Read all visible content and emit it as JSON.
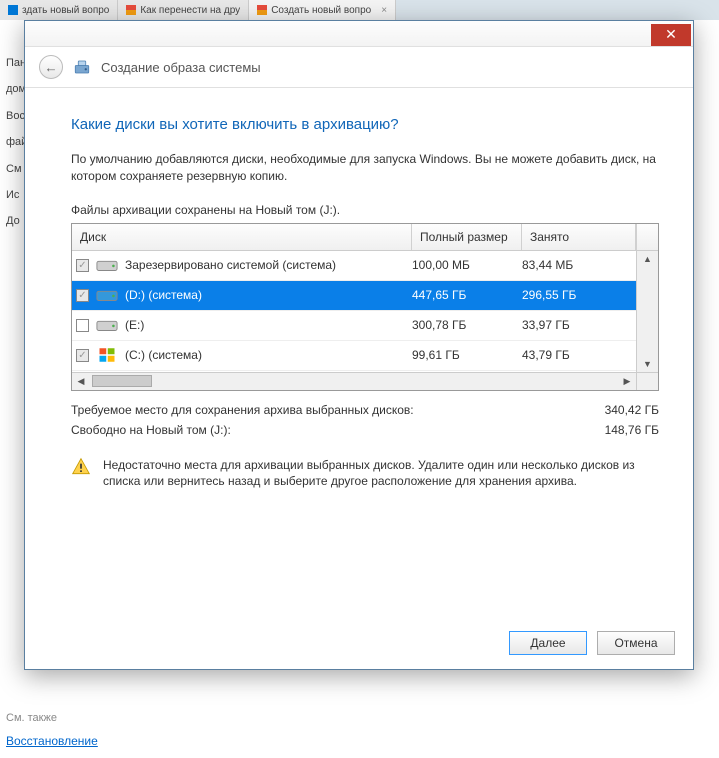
{
  "bg_tabs": [
    {
      "label": "здать новый вопро",
      "fav": "red"
    },
    {
      "label": "Как перенести на дру",
      "fav": "orange"
    },
    {
      "label": "Создать новый вопро",
      "fav": "orange"
    }
  ],
  "bg_side": [
    "Пан",
    "дом",
    "Вос",
    "фай",
    "См",
    "Ис",
    "До"
  ],
  "bg_bottom_label": "См. также",
  "bg_restore": "Восстановление",
  "dialog": {
    "title": "Создание образа системы",
    "question": "Какие диски вы хотите включить в архивацию?",
    "description": "По умолчанию добавляются диски, необходимые для запуска Windows. Вы не можете добавить диск, на котором сохраняете резервную копию.",
    "saved_on": "Файлы архивации сохранены на Новый том (J:).",
    "columns": {
      "disk": "Диск",
      "full": "Полный размер",
      "used": "Занято"
    },
    "rows": [
      {
        "checked": true,
        "disabled": true,
        "icon": "drive",
        "label": "Зарезервировано системой (система)",
        "full": "100,00 МБ",
        "used": "83,44 МБ",
        "selected": false
      },
      {
        "checked": true,
        "disabled": true,
        "icon": "drive-blue",
        "label": "(D:) (система)",
        "full": "447,65 ГБ",
        "used": "296,55 ГБ",
        "selected": true
      },
      {
        "checked": false,
        "disabled": false,
        "icon": "drive",
        "label": "(E:)",
        "full": "300,78 ГБ",
        "used": "33,97 ГБ",
        "selected": false
      },
      {
        "checked": true,
        "disabled": true,
        "icon": "windows",
        "label": "(C:) (система)",
        "full": "99,61 ГБ",
        "used": "43,79 ГБ",
        "selected": false
      }
    ],
    "required_label": "Требуемое место для сохранения архива выбранных дисков:",
    "required_value": "340,42 ГБ",
    "free_label": "Свободно на Новый том (J:):",
    "free_value": "148,76 ГБ",
    "warning": "Недостаточно места для архивации выбранных дисков. Удалите один или несколько дисков из списка или вернитесь назад и выберите другое расположение для хранения архива.",
    "next": "Далее",
    "cancel": "Отмена"
  }
}
